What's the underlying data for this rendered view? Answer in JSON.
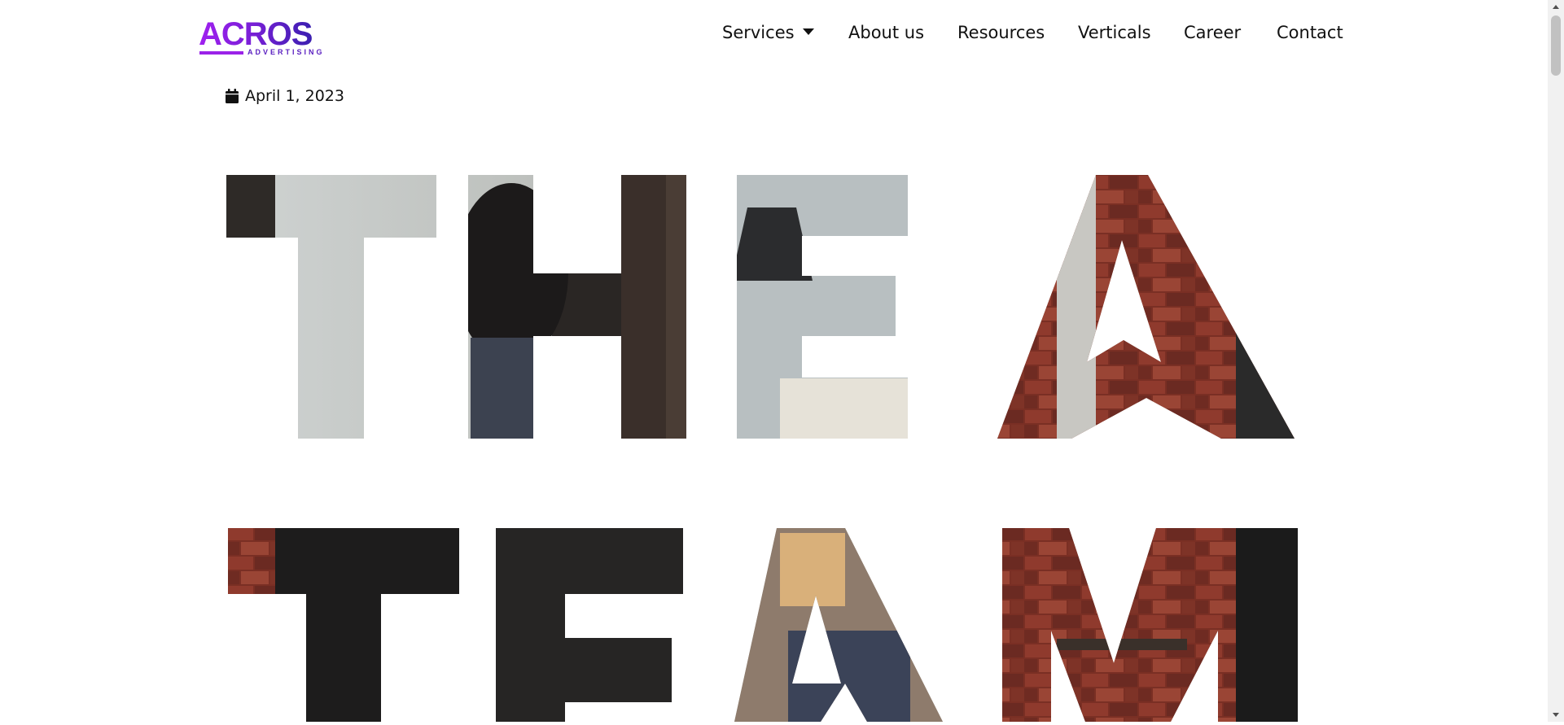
{
  "brand": {
    "name": "ACROS",
    "tagline": "ADVERTISING",
    "gradient_start": "#a020f0",
    "gradient_end": "#3b1fb0"
  },
  "nav": {
    "items": [
      {
        "label": "Services",
        "has_dropdown": true
      },
      {
        "label": "About us"
      },
      {
        "label": "Resources"
      },
      {
        "label": "Verticals"
      },
      {
        "label": "Career"
      },
      {
        "label": "Contact"
      }
    ]
  },
  "post": {
    "date": "April 1, 2023",
    "date_icon": "calendar-icon"
  },
  "hero": {
    "line1": "THE A",
    "line2": "TEAM"
  },
  "colors": {
    "text": "#111111",
    "background": "#ffffff"
  }
}
